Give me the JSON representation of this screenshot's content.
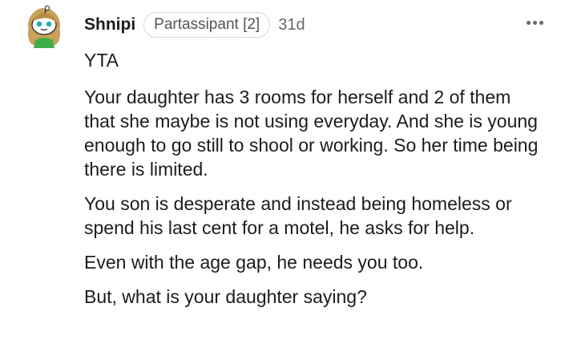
{
  "comment": {
    "username": "Shnipi",
    "flair": "Partassipant [2]",
    "timestamp": "31d",
    "paragraphs": [
      "YTA",
      "Your daughter has 3 rooms for herself and 2 of them that she maybe is not using everyday. And she is young enough to go still to shool or working. So her time being there is limited.",
      "You son is desperate and instead being homeless or spend his last cent for a motel, he asks for help.",
      "Even with the age gap, he needs you too.",
      "But, what is your daughter saying?"
    ]
  },
  "icons": {
    "avatar": "snoo-avatar-icon",
    "more": "more-options-icon"
  }
}
